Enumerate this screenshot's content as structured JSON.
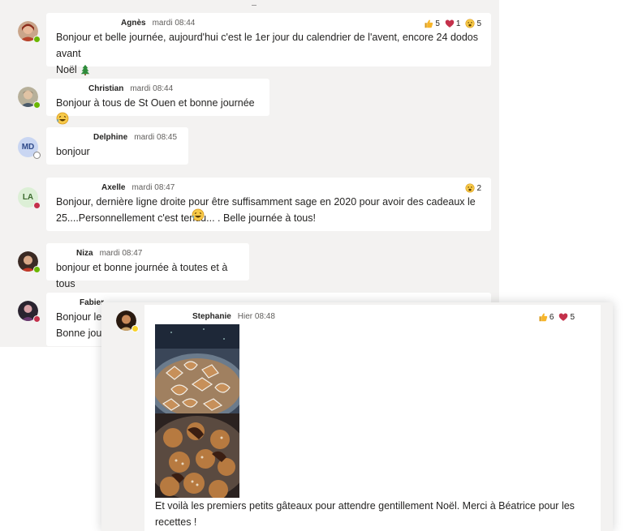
{
  "messages": [
    {
      "author": "Agnès",
      "time": "mardi 08:44",
      "text_line1": "Bonjour et belle journée, aujourd'hui c'est le 1er jour du calendrier de l'avent, encore 24 dodos avant",
      "text_line2": "Noël",
      "reactions": [
        {
          "icon": "thumbs-up-icon",
          "count": "5"
        },
        {
          "icon": "heart-icon",
          "count": "1"
        },
        {
          "icon": "surprised-emoji-icon",
          "count": "5"
        }
      ],
      "status": "available"
    },
    {
      "author": "Christian",
      "time": "mardi 08:44",
      "text_line1": "Bonjour à tous de St Ouen et bonne journée",
      "status": "available"
    },
    {
      "author": "Delphine",
      "time": "mardi 08:45",
      "initials": "MD",
      "text_line1": "bonjour",
      "status": "offline"
    },
    {
      "author": "Axelle",
      "time": "mardi 08:47",
      "initials": "LA",
      "text_line1": "Bonjour, dernière ligne droite pour être suffisamment sage en 2020 pour avoir des cadeaux le",
      "text_line2": "25....Personnellement c'est tendu... . Belle journée à tous!",
      "reactions": [
        {
          "icon": "surprised-emoji-icon",
          "count": "2"
        }
      ],
      "status": "busy"
    },
    {
      "author": "Niza",
      "time": "mardi 08:47",
      "text_line1": "bonjour et bonne journée à toutes et à tous",
      "status": "available"
    },
    {
      "author": "Fabier",
      "text_line1": "Bonjour le",
      "text_line2": "Bonne jour",
      "status": "busy"
    }
  ],
  "overlay": {
    "author": "Stephanie",
    "time": "Hier 08:48",
    "reactions": [
      {
        "icon": "thumbs-up-icon",
        "count": "6"
      },
      {
        "icon": "heart-icon",
        "count": "5"
      }
    ],
    "image_alt_icon": "cookies-photo",
    "text_line1": "Et voilà les premiers petits gâteaux pour attendre gentillement Noël. Merci à Béatrice pour les",
    "text_line2": "recettes !",
    "status": "away"
  },
  "colors": {
    "background": "#f3f2f1",
    "bubble": "#ffffff",
    "available": "#6bb700",
    "busy": "#c4314b",
    "away": "#f8d22a",
    "heart": "#c4314b",
    "like": "#f7b529"
  }
}
